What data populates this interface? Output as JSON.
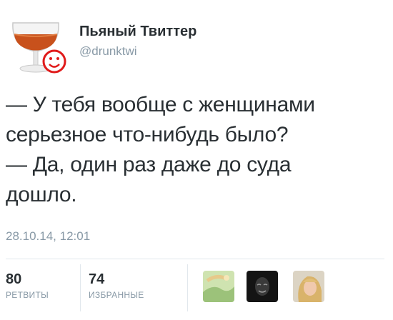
{
  "author": {
    "name": "Пьяный Твиттер",
    "handle": "@drunktwi"
  },
  "tweet": {
    "lines": [
      "— У тебя вообще с женщинами",
      "серьезное что-нибудь было?",
      "— Да, один раз даже до суда",
      "дошло."
    ],
    "timestamp": "28.10.14, 12:01"
  },
  "stats": {
    "retweets": {
      "value": "80",
      "label": "РЕТВИТЫ"
    },
    "favorites": {
      "value": "74",
      "label": "ИЗБРАННЫЕ"
    }
  },
  "favoriters": [
    {
      "icon": "landscape-avatar-icon"
    },
    {
      "icon": "masked-person-avatar-icon"
    },
    {
      "icon": "blonde-person-avatar-icon"
    }
  ]
}
